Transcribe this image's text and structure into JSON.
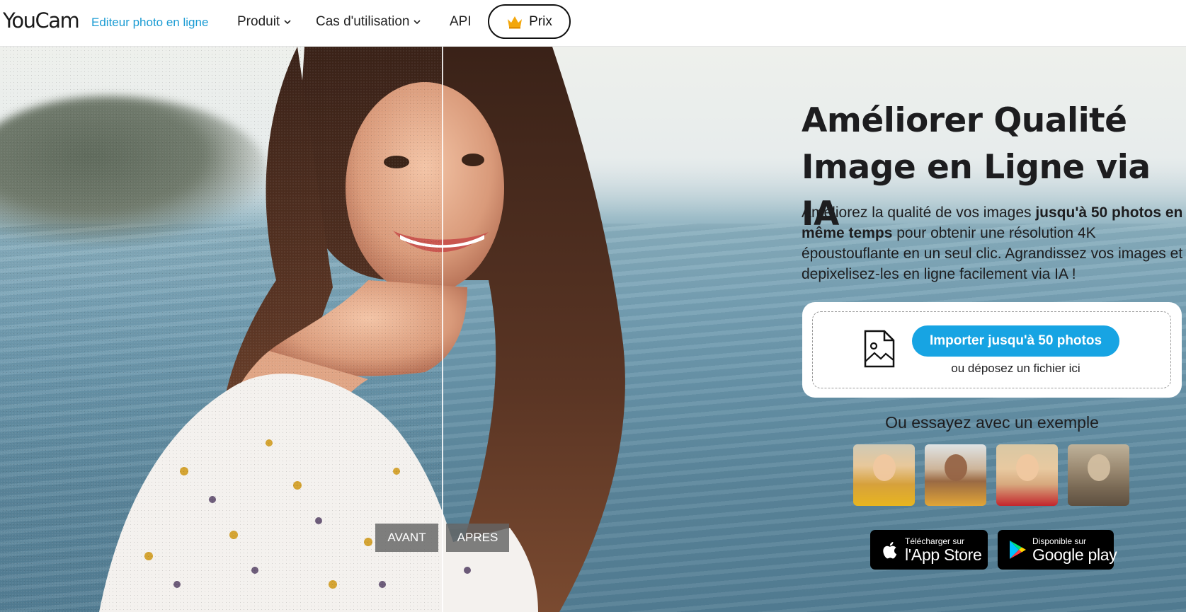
{
  "header": {
    "logo": "YouCam",
    "tagline": "Editeur photo en ligne",
    "nav": [
      {
        "label": "Produit",
        "icon": "chevron-down-icon"
      },
      {
        "label": "Cas d'utilisation",
        "icon": "chevron-down-icon"
      },
      {
        "label": "API"
      }
    ],
    "prix_label": "Prix",
    "prix_icon": "crown-icon"
  },
  "hero": {
    "before_label": "AVANT",
    "after_label": "APRES"
  },
  "main": {
    "headline": "Améliorer Qualité Image en Ligne via IA",
    "description": {
      "part1": "Améliorez la qualité de vos images ",
      "bold": "jusqu'à 50 photos en même temps",
      "part2": " pour obtenir une résolution 4K époustouflante en un seul clic. Agrandissez vos images et depixelisez-les en ligne facilement via IA !"
    },
    "upload": {
      "button_label": "Importer jusqu'à 50 photos",
      "drop_hint": "ou déposez un fichier ici",
      "icon": "image-file-icon"
    },
    "examples_title": "Ou essayez avec un exemple",
    "stores": {
      "apple_small": "Télécharger sur",
      "apple_big": "l'App Store",
      "google_small": "Disponible sur",
      "google_big": "Google play"
    }
  },
  "colors": {
    "accent": "#17a4e3",
    "tagline": "#1a9bd3",
    "text": "#1d1d1f"
  }
}
